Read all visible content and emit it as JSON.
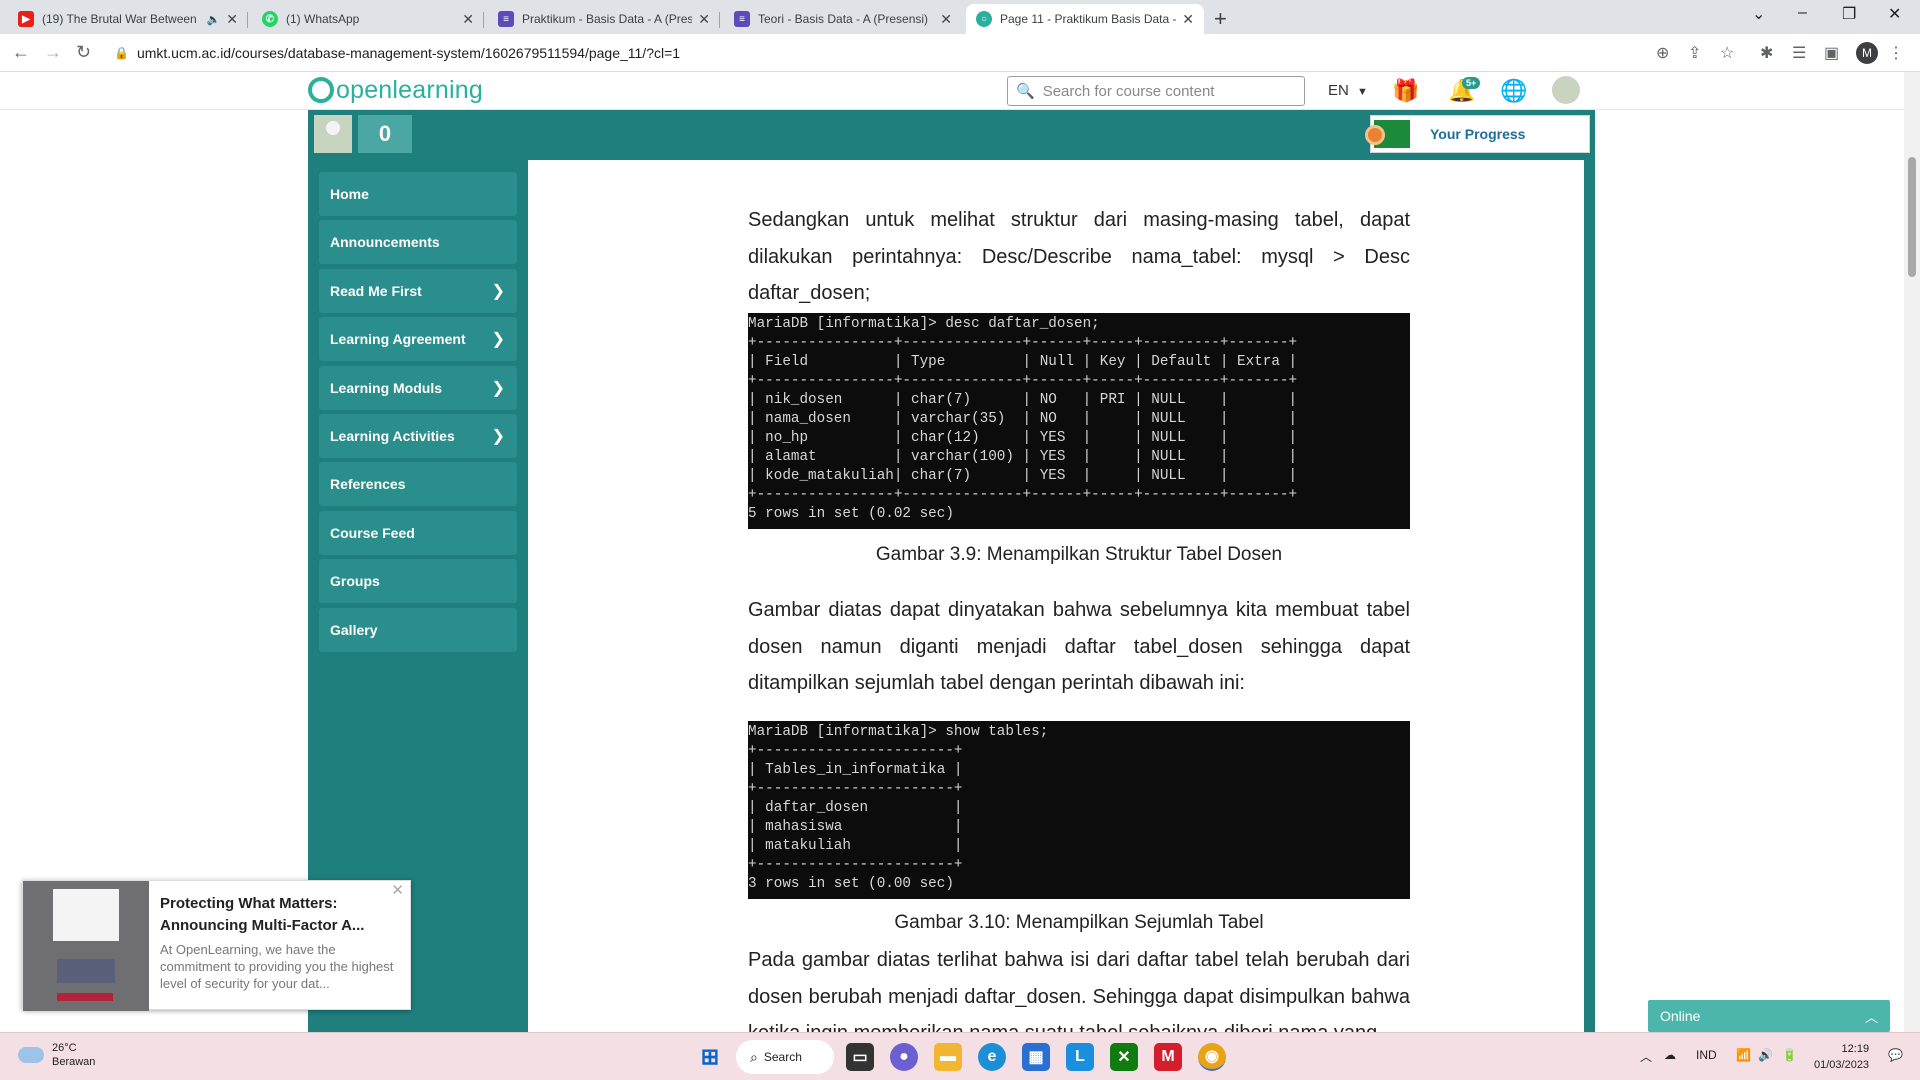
{
  "browser": {
    "tabs": [
      {
        "title": "(19) The Brutal War Between",
        "favicon_color": "#e62117"
      },
      {
        "title": "(1) WhatsApp",
        "favicon_color": "#25d366"
      },
      {
        "title": "Praktikum - Basis Data - A (Prese",
        "favicon_color": "#5c4bb8"
      },
      {
        "title": "Teori - Basis Data - A (Presensi)",
        "favicon_color": "#5c4bb8"
      },
      {
        "title": "Page 11 - Praktikum Basis Data -",
        "favicon_color": "#2bb09f"
      }
    ],
    "url": "umkt.ucm.ac.id/courses/database-management-system/1602679511594/page_11/?cl=1",
    "profile_initial": "M"
  },
  "site": {
    "logo_text": "openlearning",
    "search_placeholder": "Search for course content",
    "language": "EN",
    "notification_badge": "5+"
  },
  "course": {
    "points": "0",
    "progress_label": "Your Progress"
  },
  "sidebar": {
    "items": [
      {
        "label": "Home",
        "has_submenu": false
      },
      {
        "label": "Announcements",
        "has_submenu": false
      },
      {
        "label": "Read Me First",
        "has_submenu": true
      },
      {
        "label": "Learning Agreement",
        "has_submenu": true
      },
      {
        "label": "Learning Moduls",
        "has_submenu": true
      },
      {
        "label": "Learning Activities",
        "has_submenu": true
      },
      {
        "label": "References",
        "has_submenu": false
      },
      {
        "label": "Course Feed",
        "has_submenu": false
      },
      {
        "label": "Groups",
        "has_submenu": false
      },
      {
        "label": "Gallery",
        "has_submenu": false
      }
    ]
  },
  "content": {
    "para1": "Sedangkan untuk melihat struktur dari masing-masing tabel, dapat dilakukan perintahnya: Desc/Describe nama_tabel: mysql > Desc daftar_dosen;",
    "terminal1": [
      "MariaDB [informatika]> desc daftar_dosen;",
      "+----------------+--------------+------+-----+---------+-------+",
      "| Field          | Type         | Null | Key | Default | Extra |",
      "+----------------+--------------+------+-----+---------+-------+",
      "| nik_dosen      | char(7)      | NO   | PRI | NULL    |       |",
      "| nama_dosen     | varchar(35)  | NO   |     | NULL    |       |",
      "| no_hp          | char(12)     | YES  |     | NULL    |       |",
      "| alamat         | varchar(100) | YES  |     | NULL    |       |",
      "| kode_matakuliah| char(7)      | YES  |     | NULL    |       |",
      "+----------------+--------------+------+-----+---------+-------+",
      "5 rows in set (0.02 sec)"
    ],
    "caption1": "Gambar 3.9: Menampilkan Struktur Tabel Dosen",
    "para2": "Gambar diatas dapat dinyatakan bahwa sebelumnya kita membuat tabel dosen namun diganti menjadi daftar tabel_dosen sehingga dapat ditampilkan sejumlah tabel dengan perintah dibawah ini:",
    "terminal2": [
      "MariaDB [informatika]> show tables;",
      "+-----------------------+",
      "| Tables_in_informatika |",
      "+-----------------------+",
      "| daftar_dosen          |",
      "| mahasiswa             |",
      "| matakuliah            |",
      "+-----------------------+",
      "3 rows in set (0.00 sec)"
    ],
    "caption2": "Gambar 3.10: Menampilkan Sejumlah Tabel",
    "para3": "Pada gambar diatas terlihat bahwa isi dari daftar tabel telah berubah dari dosen berubah menjadi daftar_dosen. Sehingga dapat disimpulkan bahwa ketika ingin memberikan nama suatu tabel sebaiknya diberi nama yang"
  },
  "notification": {
    "title": "Protecting What Matters: Announcing Multi-Factor A...",
    "body": "At OpenLearning, we have the commitment to providing you the highest level of security for your dat..."
  },
  "chat": {
    "label": "Online"
  },
  "taskbar": {
    "weather_temp": "26°C",
    "weather_desc": "Berawan",
    "search_label": "Search",
    "language": "IND",
    "time": "12:19",
    "date": "01/03/2023"
  }
}
